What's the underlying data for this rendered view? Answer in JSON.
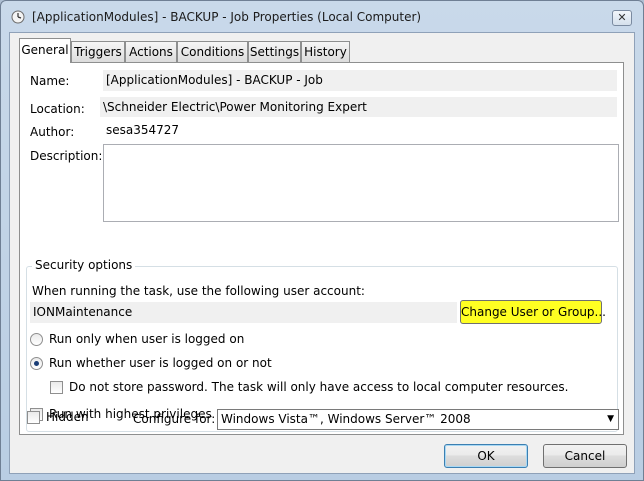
{
  "window": {
    "title": "[ApplicationModules] - BACKUP - Job Properties (Local Computer)",
    "close_glyph": "✕"
  },
  "tabs": [
    {
      "label": "General"
    },
    {
      "label": "Triggers"
    },
    {
      "label": "Actions"
    },
    {
      "label": "Conditions"
    },
    {
      "label": "Settings"
    },
    {
      "label": "History"
    }
  ],
  "general": {
    "name_label": "Name:",
    "name_value": "[ApplicationModules] - BACKUP - Job",
    "location_label": "Location:",
    "location_value": "\\Schneider Electric\\Power Monitoring Expert",
    "author_label": "Author:",
    "author_value": "sesa354727",
    "description_label": "Description:",
    "description_value": ""
  },
  "security": {
    "group_title": "Security options",
    "account_prompt": "When running the task, use the following user account:",
    "account_value": "IONMaintenance",
    "change_user_button": "Change User or Group...",
    "radio_logged_on": "Run only when user is logged on",
    "radio_whether": "Run whether user is logged on or not",
    "radio_selected": "whether",
    "no_store_password": "Do not store password.  The task will only have access to local computer resources.",
    "highest_privileges": "Run with highest privileges"
  },
  "footer": {
    "hidden_label": "Hidden",
    "configure_label": "Configure for:",
    "configure_value": "Windows Vista™, Windows Server™ 2008",
    "ok_button": "OK",
    "cancel_button": "Cancel"
  },
  "colors": {
    "highlight_button": "#ffff22",
    "title_bar": "#c9d9ea"
  }
}
